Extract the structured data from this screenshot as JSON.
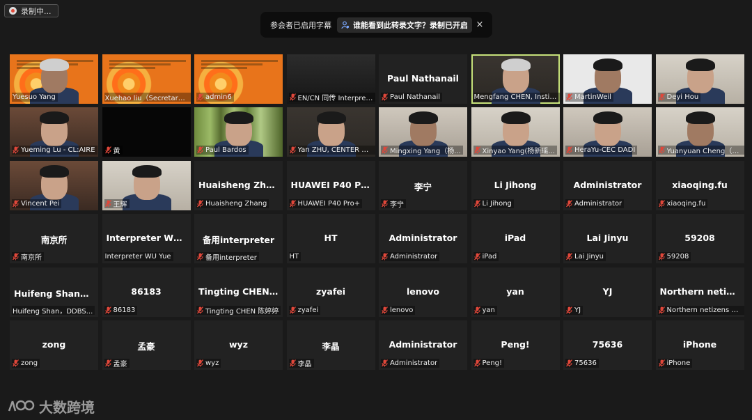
{
  "recording": {
    "label": "录制中..."
  },
  "notice": {
    "text": "参会者已启用字幕",
    "link": "谁能看到此转录文字？录制已开启",
    "close": "×"
  },
  "tiles": [
    {
      "name": "Yuesuo Yang",
      "caption": "Yuesuo Yang",
      "video": "slide",
      "mic": false,
      "person": true
    },
    {
      "name": "Xuehao liu（Secretary）",
      "caption": "Xuehao liu（Secretary）",
      "video": "slide",
      "mic": false,
      "person": false
    },
    {
      "name": "admin6",
      "caption": "admin6",
      "video": "slide",
      "mic": true,
      "person": false
    },
    {
      "name": "EN/CN 同传 Interpreter",
      "caption": "EN/CN 同传 Interpret...",
      "video": "dark",
      "mic": true,
      "person": false
    },
    {
      "name": "Paul Nathanail",
      "caption": "Paul Nathanail",
      "big": "Paul Nathanail",
      "mic": true
    },
    {
      "name": "Mengfang CHEN",
      "caption": "Mengfang CHEN, Institut...",
      "video": "room",
      "mic": false,
      "person": true,
      "active": true
    },
    {
      "name": "MartinWeil",
      "caption": "MartinWeil",
      "video": "white",
      "mic": true,
      "person": true
    },
    {
      "name": "Deyi Hou",
      "caption": "Deyi Hou",
      "video": "room3",
      "mic": true,
      "person": true
    },
    {
      "name": "Yueming Lu - CL:AIRE",
      "caption": "Yueming Lu - CL:AIRE",
      "video": "warm",
      "mic": true,
      "person": true
    },
    {
      "name": "黄",
      "caption": "黄",
      "video": "black",
      "mic": true,
      "person": false
    },
    {
      "name": "Paul Bardos",
      "caption": "Paul Bardos",
      "video": "forest",
      "mic": true,
      "person": true
    },
    {
      "name": "Yan ZHU, CENTER Gr",
      "caption": "Yan ZHU, CENTER Gr...",
      "video": "room",
      "mic": true,
      "person": true
    },
    {
      "name": "Mingxing Yang",
      "caption": "Mingxing Yang（杨...",
      "video": "room2",
      "mic": true,
      "person": true
    },
    {
      "name": "Xinyao Yang",
      "caption": "Xinyao Yang(杨新瑶...",
      "video": "room3",
      "mic": true,
      "person": true
    },
    {
      "name": "HeraYu-CEC DADI",
      "caption": "HeraYu-CEC DADI",
      "video": "room2",
      "mic": true,
      "person": true
    },
    {
      "name": "Yuanyuan Cheng",
      "caption": "Yuanyuan Cheng（程...",
      "video": "room3",
      "mic": true,
      "person": true
    },
    {
      "name": "Vincent Pei",
      "caption": "Vincent Pei",
      "video": "warm",
      "mic": true,
      "person": true
    },
    {
      "name": "王辉",
      "caption": "王辉",
      "video": "room3",
      "mic": true,
      "person": true
    },
    {
      "name": "Huaisheng Zhang",
      "caption": "Huaisheng Zhang",
      "big": "Huaisheng Zhang",
      "mic": true
    },
    {
      "name": "HUAWEI P40 Pro+",
      "caption": "HUAWEI P40 Pro+",
      "big": "HUAWEI P40 Pr...",
      "mic": true
    },
    {
      "name": "李宁",
      "caption": "李宁",
      "big": "李宁",
      "mic": true
    },
    {
      "name": "Li Jihong",
      "caption": "Li Jihong",
      "big": "Li Jihong",
      "mic": true
    },
    {
      "name": "Administrator",
      "caption": "Administrator",
      "big": "Administrator",
      "mic": true
    },
    {
      "name": "xiaoqing.fu",
      "caption": "xiaoqing.fu",
      "big": "xiaoqing.fu",
      "mic": true
    },
    {
      "name": "南京所",
      "caption": "南京所",
      "big": "南京所",
      "mic": true
    },
    {
      "name": "Interpreter WU Yue",
      "caption": "Interpreter WU Yue",
      "big": "Interpreter WU...",
      "mic": false
    },
    {
      "name": "备用interpreter",
      "caption": "备用interpreter",
      "big": "备用interpreter",
      "mic": true
    },
    {
      "name": "HT",
      "caption": "HT",
      "big": "HT",
      "mic": false
    },
    {
      "name": "Administrator",
      "caption": "Administrator",
      "big": "Administrator",
      "mic": true
    },
    {
      "name": "iPad",
      "caption": "iPad",
      "big": "iPad",
      "mic": true
    },
    {
      "name": "Lai Jinyu",
      "caption": "Lai Jinyu",
      "big": "Lai Jinyu",
      "mic": true
    },
    {
      "name": "59208",
      "caption": "59208",
      "big": "59208",
      "mic": true
    },
    {
      "name": "Huifeng Shan, DDBS",
      "caption": "Huifeng Shan，DDBS...",
      "big": "Huifeng Shan，...",
      "mic": false
    },
    {
      "name": "86183",
      "caption": "86183",
      "big": "86183",
      "mic": true
    },
    {
      "name": "Tingting CHEN 陈婷婷",
      "caption": "Tingting CHEN 陈婷婷",
      "big": "Tingting CHEN...",
      "mic": true
    },
    {
      "name": "zyafei",
      "caption": "zyafei",
      "big": "zyafei",
      "mic": true
    },
    {
      "name": "lenovo",
      "caption": "lenovo",
      "big": "lenovo",
      "mic": true
    },
    {
      "name": "yan",
      "caption": "yan",
      "big": "yan",
      "mic": true
    },
    {
      "name": "YJ",
      "caption": "YJ",
      "big": "YJ",
      "mic": true
    },
    {
      "name": "Northern netizens",
      "caption": "Northern netizens wh...",
      "big": "Northern netize...",
      "mic": true
    },
    {
      "name": "zong",
      "caption": "zong",
      "big": "zong",
      "mic": true
    },
    {
      "name": "孟豪",
      "caption": "孟豪",
      "big": "孟豪",
      "mic": true
    },
    {
      "name": "wyz",
      "caption": "wyz",
      "big": "wyz",
      "mic": true
    },
    {
      "name": "李晶",
      "caption": "李晶",
      "big": "李晶",
      "mic": true
    },
    {
      "name": "Administrator",
      "caption": "Administrator",
      "big": "Administrator",
      "mic": true
    },
    {
      "name": "Peng!",
      "caption": "Peng!",
      "big": "Peng!",
      "mic": true
    },
    {
      "name": "75636",
      "caption": "75636",
      "big": "75636",
      "mic": true
    },
    {
      "name": "iPhone",
      "caption": "iPhone",
      "big": "iPhone",
      "mic": true
    }
  ],
  "watermark": {
    "text": "大数跨境"
  },
  "colors": {
    "muted_mic": "#e0473a",
    "active_border": "#c7e27a",
    "tile_bg": "#222222",
    "page_bg": "#1a1a1a"
  }
}
